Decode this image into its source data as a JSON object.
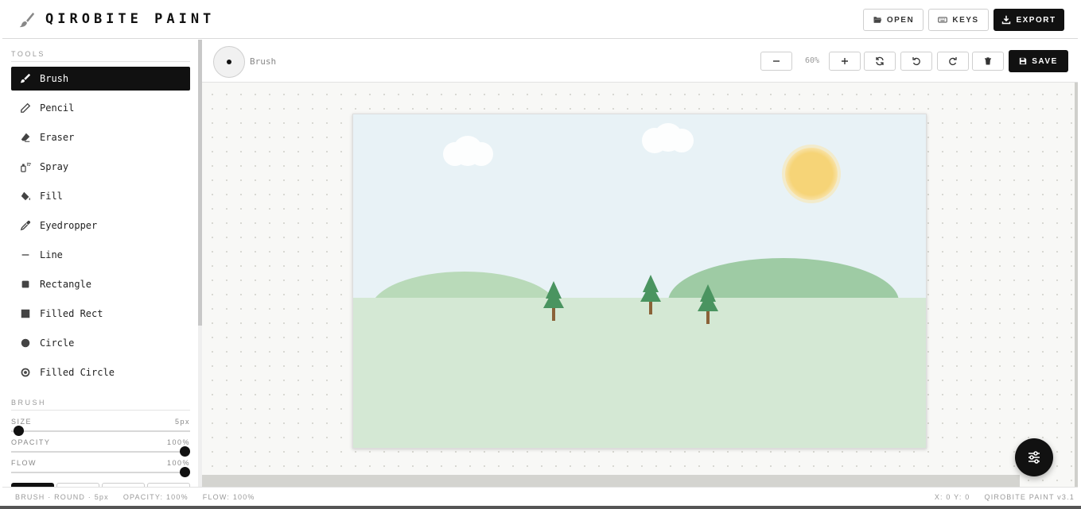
{
  "app": {
    "title": "QIROBITE PAINT"
  },
  "header": {
    "open_label": "OPEN",
    "keys_label": "KEYS",
    "export_label": "EXPORT"
  },
  "sidebar": {
    "tools_title": "TOOLS",
    "tools": [
      {
        "label": "Brush",
        "icon": "brush-icon",
        "active": true
      },
      {
        "label": "Pencil",
        "icon": "pencil-icon"
      },
      {
        "label": "Eraser",
        "icon": "eraser-icon"
      },
      {
        "label": "Spray",
        "icon": "spray-icon"
      },
      {
        "label": "Fill",
        "icon": "fill-bucket-icon"
      },
      {
        "label": "Eyedropper",
        "icon": "eyedropper-icon"
      },
      {
        "label": "Line",
        "icon": "line-icon"
      },
      {
        "label": "Rectangle",
        "icon": "rectangle-icon"
      },
      {
        "label": "Filled Rect",
        "icon": "filled-rect-icon"
      },
      {
        "label": "Circle",
        "icon": "circle-icon"
      },
      {
        "label": "Filled Circle",
        "icon": "filled-circle-icon"
      }
    ],
    "brush_title": "BRUSH",
    "size": {
      "label": "SIZE",
      "value": "5px",
      "fraction": 0.0
    },
    "opacity": {
      "label": "OPACITY",
      "value": "100%",
      "fraction": 1.0
    },
    "flow": {
      "label": "FLOW",
      "value": "100%",
      "fraction": 1.0
    }
  },
  "toolbar": {
    "brush_name": "Brush",
    "zoom": "60%",
    "save_label": "SAVE"
  },
  "status": {
    "brush": "BRUSH · ROUND · 5px",
    "opacity": "OPACITY: 100%",
    "flow": "FLOW: 100%",
    "coords": "X: 0 Y: 0",
    "version": "QIROBITE PAINT v3.1"
  },
  "colors": {
    "accent": "#111111",
    "sky": "#e8f2f6",
    "grass": "#d4e8d4",
    "hill": "#9ecba4",
    "sun": "#f6d477",
    "tree": "#4a9460",
    "trunk": "#8a6238"
  }
}
